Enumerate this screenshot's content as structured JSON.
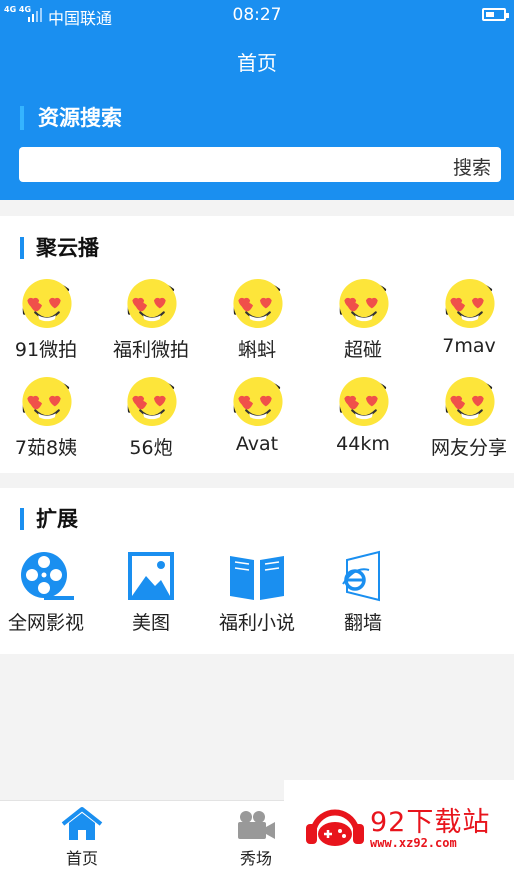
{
  "status_bar": {
    "signal_text": "4G 4G",
    "carrier": "中国联通",
    "time": "08:27"
  },
  "header": {
    "title": "首页"
  },
  "search": {
    "heading": "资源搜索",
    "placeholder": "",
    "value": "",
    "button_label": "搜索"
  },
  "juyunbo": {
    "title": "聚云播",
    "items": [
      {
        "label": "91微拍",
        "icon": "heart-eyes-emoji-icon"
      },
      {
        "label": "福利微拍",
        "icon": "heart-eyes-emoji-icon"
      },
      {
        "label": "蝌蚪",
        "icon": "heart-eyes-emoji-icon"
      },
      {
        "label": "超碰",
        "icon": "heart-eyes-emoji-icon"
      },
      {
        "label": "7mav",
        "icon": "heart-eyes-emoji-icon"
      },
      {
        "label": "7茹8姨",
        "icon": "heart-eyes-emoji-icon"
      },
      {
        "label": "56炮",
        "icon": "heart-eyes-emoji-icon"
      },
      {
        "label": "Avat",
        "icon": "heart-eyes-emoji-icon"
      },
      {
        "label": "44km",
        "icon": "heart-eyes-emoji-icon"
      },
      {
        "label": "网友分享",
        "icon": "heart-eyes-emoji-icon"
      }
    ]
  },
  "extension": {
    "title": "扩展",
    "items": [
      {
        "label": "全网影视",
        "icon": "film-reel-icon"
      },
      {
        "label": "美图",
        "icon": "picture-icon"
      },
      {
        "label": "福利小说",
        "icon": "open-book-icon"
      },
      {
        "label": "翻墙",
        "icon": "ie-window-icon"
      }
    ]
  },
  "tabbar": {
    "items": [
      {
        "label": "首页",
        "icon": "home-icon"
      },
      {
        "label": "秀场",
        "icon": "video-camera-icon"
      }
    ]
  },
  "watermark": {
    "text": "92下载站",
    "url": "www.xz92.com"
  },
  "colors": {
    "primary": "#1a8ff0",
    "accent": "#35b4ff",
    "emoji_yellow": "#fde53a",
    "heart_red": "#f0504a",
    "watermark_red": "#e8141c"
  }
}
